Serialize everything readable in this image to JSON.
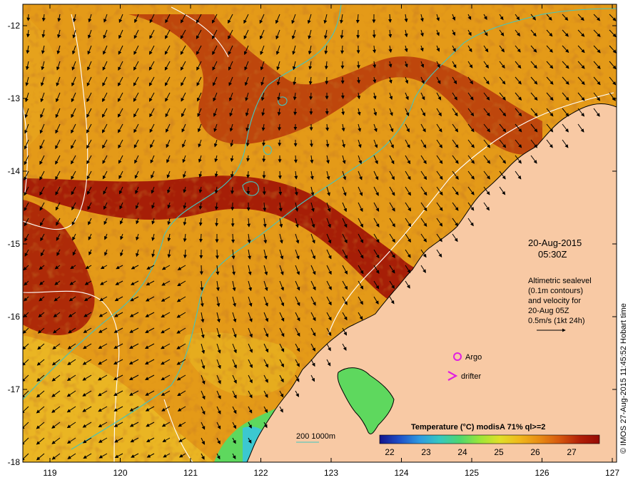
{
  "map": {
    "lon_ticks": [
      "119",
      "120",
      "121",
      "122",
      "123",
      "124",
      "125",
      "126",
      "127"
    ],
    "lat_ticks": [
      "-12",
      "-13",
      "-14",
      "-15",
      "-16",
      "-17",
      "-18"
    ],
    "colors": {
      "land": "#f8c9a4",
      "sea_hot": "#a11406",
      "sea_warm": "#cf5d12",
      "sea_mid": "#e49a18",
      "contour_shelf": "#41c6c0",
      "contour_sealevel": "#ffffff"
    }
  },
  "annotation": {
    "date_line1": "20-Aug-2015",
    "date_line2": "05:30Z",
    "alt_line1": "Altimetric sealevel",
    "alt_line2": "(0.1m contours)",
    "alt_line3": "and velocity for",
    "alt_line4": "20-Aug 05Z",
    "alt_line5": "0.5m/s (1kt 24h)"
  },
  "legend": {
    "argo_label": "Argo",
    "drifter_label": "drifter",
    "depth_label": "200  1000m",
    "argo_color": "#e020e0",
    "drifter_color": "#e020e0"
  },
  "colorbar": {
    "title": "Temperature  (°C) modisA 71% ql>=2",
    "ticks": [
      "22",
      "23",
      "24",
      "25",
      "26",
      "27"
    ],
    "stops": [
      "#14148c",
      "#1e50c8",
      "#2e9ae0",
      "#36c8c0",
      "#4ed670",
      "#9ae63a",
      "#e0e028",
      "#f0b81c",
      "#e88c14",
      "#d6580e",
      "#b22008",
      "#960a04"
    ]
  },
  "credit": "© IMOS 27-Aug-2015 11:45:52 Hobart time"
}
